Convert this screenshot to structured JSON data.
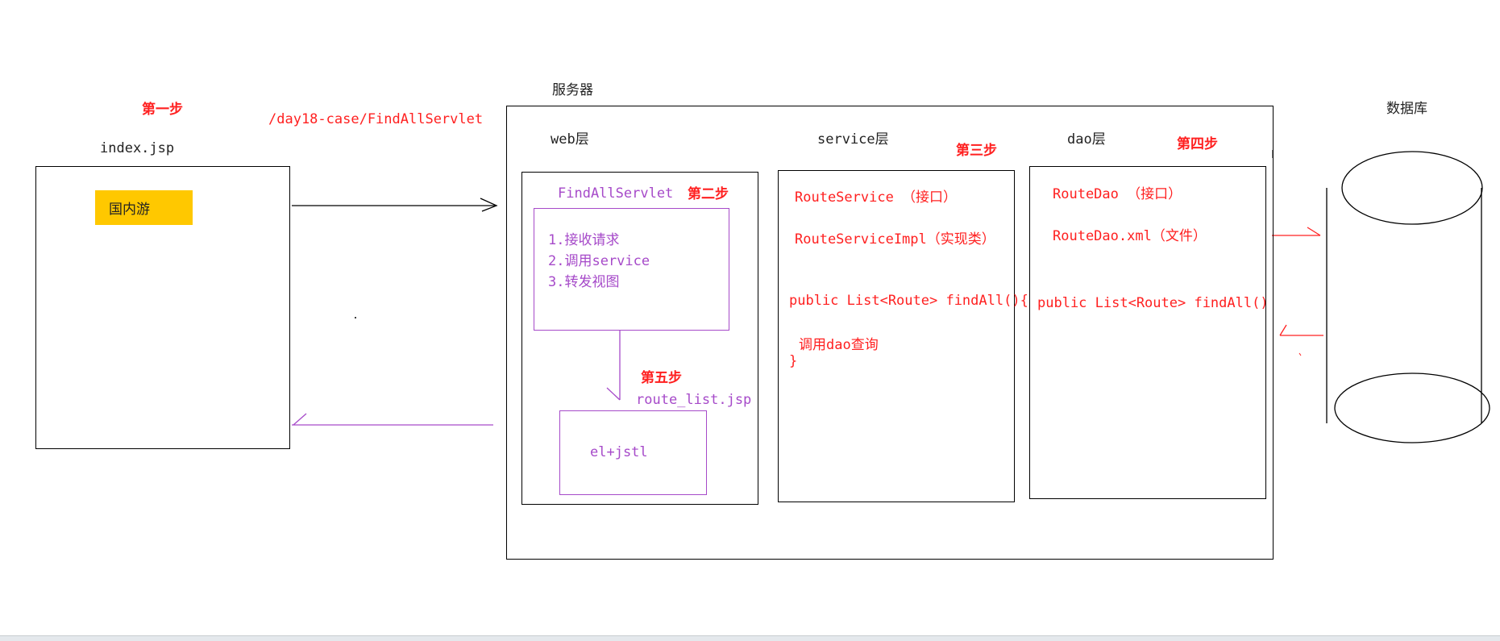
{
  "steps": {
    "step1": "第一步",
    "step2": "第二步",
    "step3": "第三步",
    "step4": "第四步",
    "step5": "第五步"
  },
  "client": {
    "page_name": "index.jsp",
    "button_label": "国内游",
    "button_color": "#ffc800"
  },
  "request_url": "/day18-case/FindAllServlet",
  "server": {
    "title": "服务器",
    "web_layer": {
      "title": "web层",
      "servlet_name": "FindAllServlet",
      "servlet_steps": [
        "1.接收请求",
        "2.调用service",
        "3.转发视图"
      ],
      "jsp_name": "route_list.jsp",
      "jsp_content": "el+jstl"
    },
    "service_layer": {
      "title": "service层",
      "interface": "RouteService （接口）",
      "impl": "RouteServiceImpl（实现类）",
      "method": "public List<Route> findAll(){",
      "call": "调用dao查询",
      "close_brace": "}"
    },
    "dao_layer": {
      "title": "dao层",
      "interface": "RouteDao （接口）",
      "xml": "RouteDao.xml（文件）",
      "method": "public List<Route> findAll()"
    }
  },
  "database": {
    "title": "数据库"
  },
  "colors": {
    "step_red": "#ff2020",
    "code_red": "#ff2020",
    "web_purple": "#a64ac9",
    "line_black": "#000000"
  }
}
